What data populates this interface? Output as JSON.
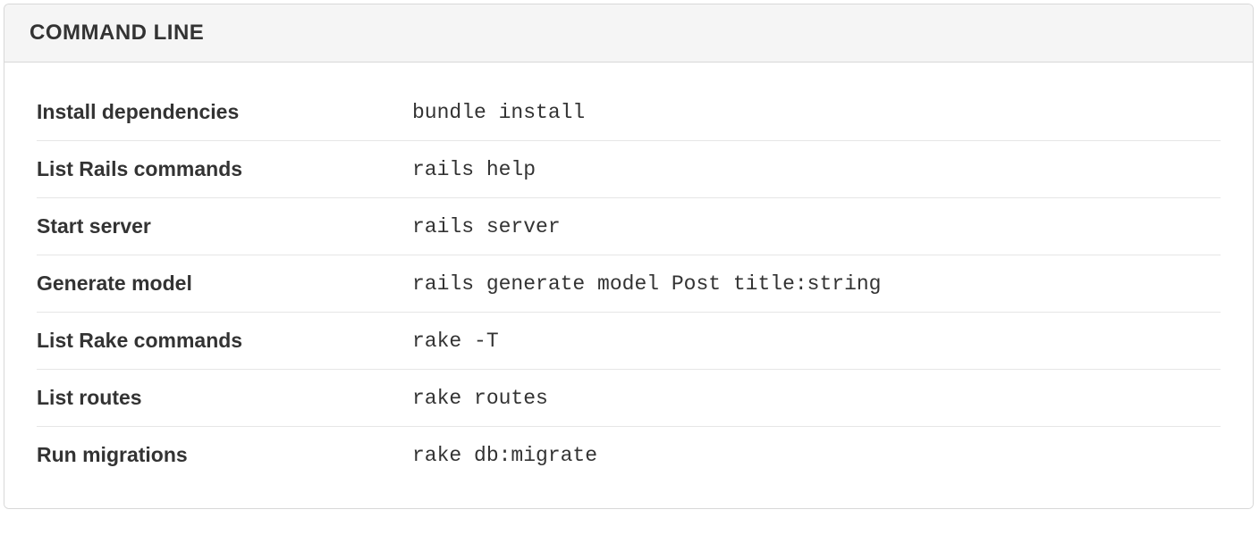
{
  "section": {
    "title": "COMMAND LINE",
    "rows": [
      {
        "label": "Install dependencies",
        "command": "bundle install"
      },
      {
        "label": "List Rails commands",
        "command": "rails help"
      },
      {
        "label": "Start server",
        "command": "rails server"
      },
      {
        "label": "Generate model",
        "command": "rails generate model Post title:string"
      },
      {
        "label": "List Rake commands",
        "command": "rake -T"
      },
      {
        "label": "List routes",
        "command": "rake routes"
      },
      {
        "label": "Run migrations",
        "command": "rake db:migrate"
      }
    ]
  }
}
